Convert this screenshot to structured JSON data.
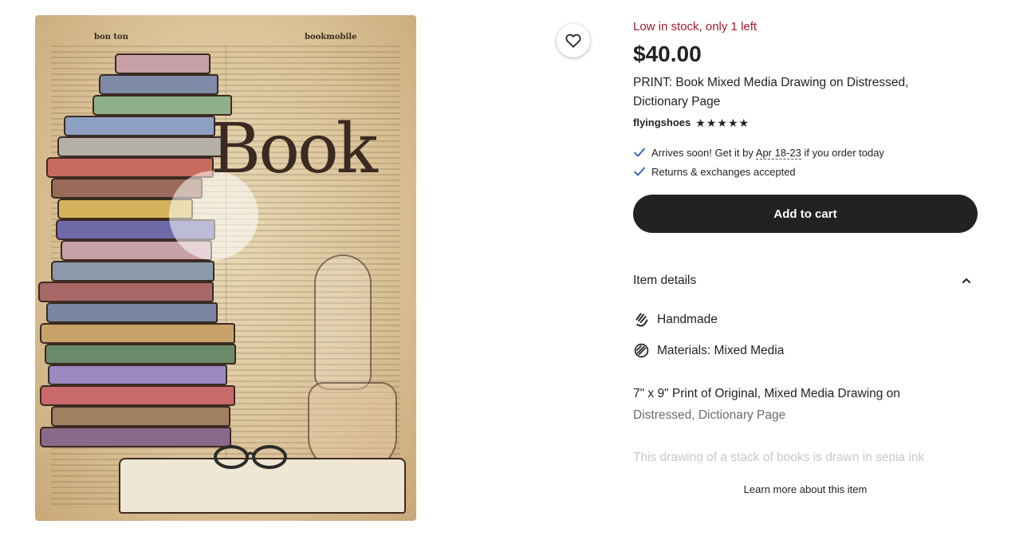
{
  "product_image": {
    "dictionary_guide_left": "bon ton",
    "dictionary_guide_right": "bookmobile",
    "art_word": "Book"
  },
  "favorite": {
    "icon": "heart-icon"
  },
  "listing": {
    "stock_text": "Low in stock, only 1 left",
    "price": "$40.00",
    "title": "PRINT: Book Mixed Media Drawing on Distressed, Dictionary Page",
    "shop_name": "flyingshoes",
    "rating_stars": [
      "★",
      "★",
      "★",
      "★",
      "★"
    ],
    "rating_value": 5
  },
  "perks": {
    "arrival_prefix": "Arrives soon! Get it by ",
    "arrival_dates": "Apr 18-23",
    "arrival_suffix": " if you order today",
    "returns": "Returns & exchanges accepted"
  },
  "cart": {
    "label": "Add to cart"
  },
  "item_details": {
    "header": "Item details",
    "handmade": "Handmade",
    "materials": "Materials: Mixed Media",
    "desc_line1": "7\" x 9\" Print of Original, Mixed Media Drawing on",
    "desc_line2": "Distressed, Dictionary Page",
    "desc_fade": "This drawing of a stack of books is drawn in sepia ink",
    "learn_more": "Learn more about this item"
  },
  "colors": {
    "stock_red": "#a61a2e",
    "cart_bg": "#222222",
    "check_blue": "#2f5fb5"
  }
}
